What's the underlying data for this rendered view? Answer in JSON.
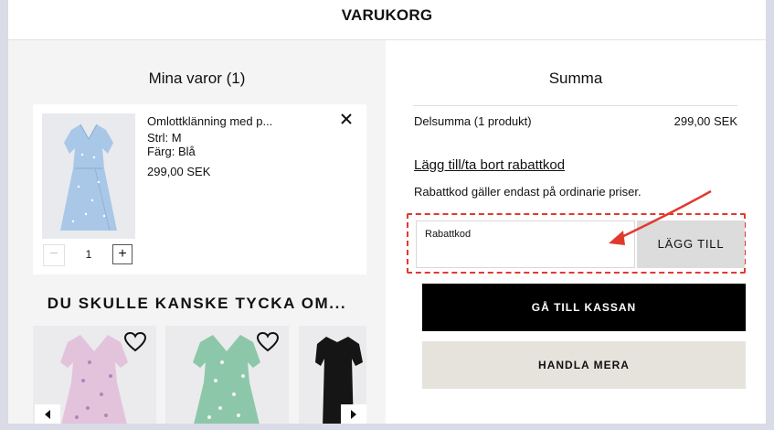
{
  "header": {
    "title": "VARUKORG"
  },
  "cart": {
    "title": "Mina varor (1)",
    "item": {
      "name": "Omlottklänning med p...",
      "size": "Strl: M",
      "color": "Färg: Blå",
      "price": "299,00 SEK",
      "quantity": "1",
      "remove_icon": "close-icon",
      "minus_label": "−",
      "plus_label": "+"
    }
  },
  "recommendations": {
    "title": "DU SKULLE KANSKE TYCKA OM...",
    "nav_prev_icon": "arrow-left-icon",
    "nav_next_icon": "arrow-right-icon",
    "items": [
      {
        "image": "pink-floral-dress",
        "favorite_icon": "heart-icon"
      },
      {
        "image": "green-floral-dress",
        "favorite_icon": "heart-icon"
      },
      {
        "image": "black-dress"
      }
    ]
  },
  "summary": {
    "title": "Summa",
    "subtotal_label": "Delsumma (1 produkt)",
    "subtotal_value": "299,00 SEK",
    "discount_link": "Lägg till/ta bort rabattkod",
    "discount_note": "Rabattkod gäller endast på ordinarie priser.",
    "code_label": "Rabattkod",
    "code_value": "",
    "add_button": "LÄGG TILL",
    "checkout_button": "GÅ TILL KASSAN",
    "continue_button": "HANDLA MERA"
  },
  "colors": {
    "page_bg": "#d9dbe6",
    "panel_bg": "#f4f4f4",
    "checkout_bg": "#000000",
    "continue_bg": "#e6e3dd",
    "annotation_red": "#e03a2f"
  }
}
